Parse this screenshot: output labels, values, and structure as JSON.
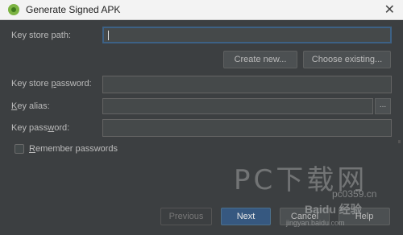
{
  "window": {
    "title": "Generate Signed APK",
    "close_glyph": "✕"
  },
  "form": {
    "key_store_path_label": "Key store path:",
    "key_store_path_value": "",
    "create_new_label": "Create new...",
    "choose_existing_label": "Choose existing...",
    "key_store_password_label_pre": "Key store ",
    "key_store_password_label_mnemonic": "p",
    "key_store_password_label_post": "assword:",
    "key_store_password_value": "",
    "key_alias_label_pre": "",
    "key_alias_label_mnemonic": "K",
    "key_alias_label_post": "ey alias:",
    "key_alias_value": "",
    "browse_glyph": "...",
    "key_password_label_pre": "Key pass",
    "key_password_label_mnemonic": "w",
    "key_password_label_post": "ord:",
    "key_password_value": "",
    "remember_label_mnemonic": "R",
    "remember_label_post": "emember passwords",
    "remember_checked": false
  },
  "footer": {
    "previous_label": "Previous",
    "next_label": "Next",
    "cancel_label": "Cancel",
    "help_label": "Help"
  },
  "watermark": {
    "main": "PC下载网",
    "url": "pc0359.cn",
    "logo": "Baidu 经验",
    "sub": "jingyan.baidu.com"
  },
  "colors": {
    "background": "#3c3f41",
    "accent": "#365880",
    "focus_border": "#3d6185"
  }
}
